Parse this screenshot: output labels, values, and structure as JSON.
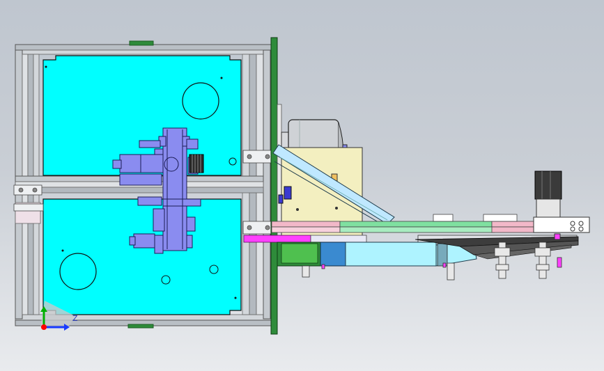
{
  "viewport": {
    "background_top": "#bfc6cf",
    "background_bottom": "#e9ebee"
  },
  "colors": {
    "frame": "#b9bfc5",
    "panel": "#00ffff",
    "plate_green": "#2e8b3a",
    "actuator_blue": "#8a8cf0",
    "motor_gray": "#cfd2d6",
    "bracket_yellow": "#f3efc0",
    "strip_pink": "#f2b8c8",
    "strip_green": "#7fe0a0",
    "magenta": "#ff40ff",
    "arm_cyan": "#aef3ff",
    "dark_gray": "#3d3d3d"
  },
  "triad": {
    "x_axis_label": "Z",
    "x_color": "#1a3bff",
    "y_color": "#00b000",
    "origin_color": "#ff0000"
  }
}
